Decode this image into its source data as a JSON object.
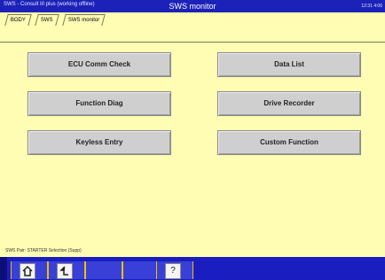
{
  "titlebar": {
    "left": "SWS - Consult III plus (working offline)",
    "title": "SWS monitor",
    "right": "12:31 4:06"
  },
  "tabs": [
    {
      "label": "BODY"
    },
    {
      "label": "SWS"
    },
    {
      "label": "SWS monitor"
    }
  ],
  "buttons": [
    {
      "label": "ECU Comm Check"
    },
    {
      "label": "Data List"
    },
    {
      "label": "Function Diag"
    },
    {
      "label": "Drive Recorder"
    },
    {
      "label": "Keyless Entry"
    },
    {
      "label": "Custom Function"
    }
  ],
  "status": "SWS Pair: STARTER Selection (Supp)",
  "toolbar": {
    "home_icon": "home-icon",
    "back_icon": "back-icon",
    "help_icon": "help-icon",
    "help_glyph": "?"
  }
}
